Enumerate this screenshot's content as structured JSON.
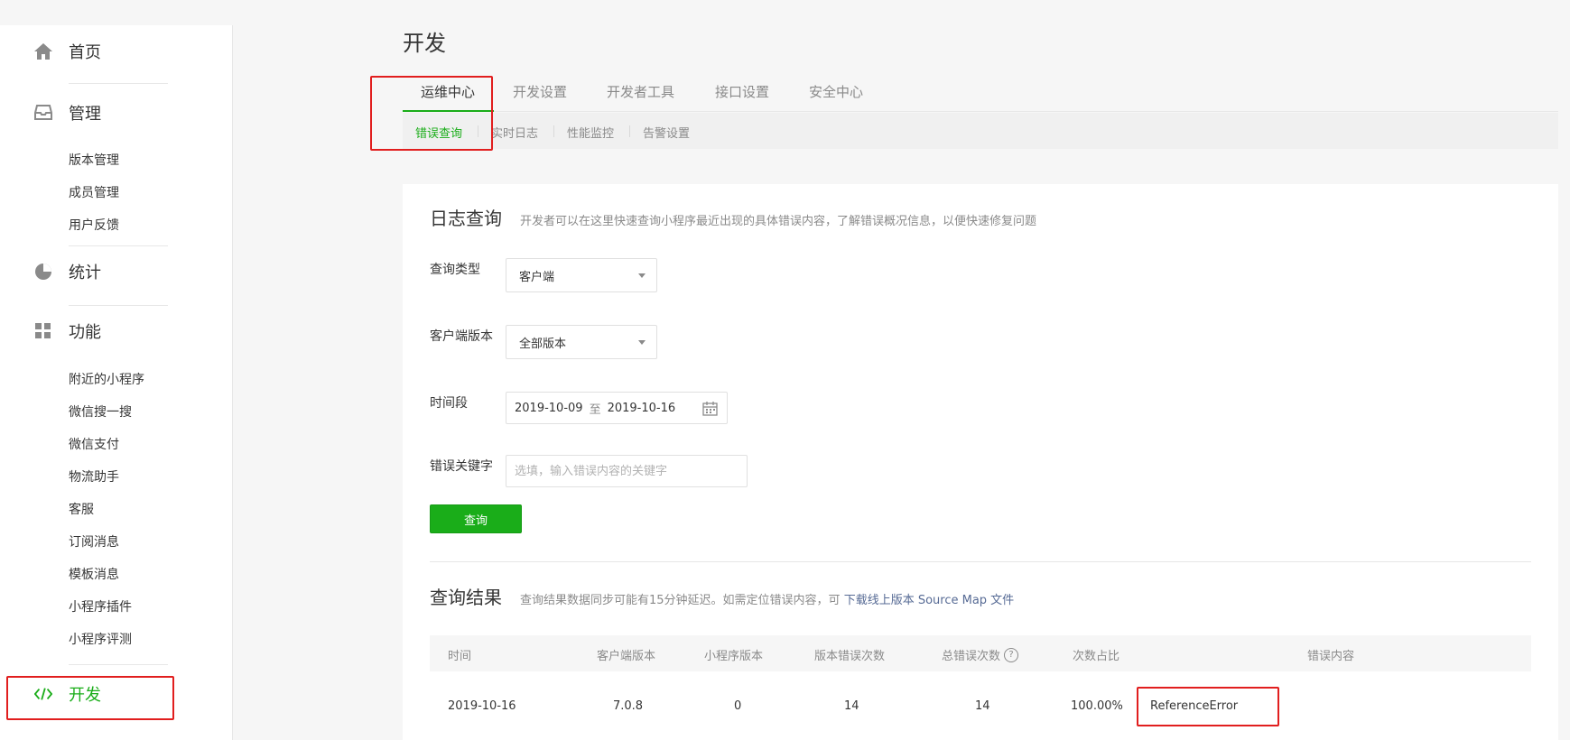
{
  "sidebar": {
    "home": {
      "label": "首页"
    },
    "manage": {
      "label": "管理",
      "items": [
        "版本管理",
        "成员管理",
        "用户反馈"
      ]
    },
    "stats": {
      "label": "统计"
    },
    "features": {
      "label": "功能",
      "items": [
        "附近的小程序",
        "微信搜一搜",
        "微信支付",
        "物流助手",
        "客服",
        "订阅消息",
        "模板消息",
        "小程序插件",
        "小程序评测"
      ]
    },
    "dev": {
      "label": "开发"
    }
  },
  "header": {
    "title": "开发"
  },
  "tabs": [
    "运维中心",
    "开发设置",
    "开发者工具",
    "接口设置",
    "安全中心"
  ],
  "subtabs": [
    "错误查询",
    "实时日志",
    "性能监控",
    "告警设置"
  ],
  "log_query": {
    "title": "日志查询",
    "desc": "开发者可以在这里快速查询小程序最近出现的具体错误内容，了解错误概况信息，以便快速修复问题",
    "query_type_label": "查询类型",
    "query_type_value": "客户端",
    "client_version_label": "客户端版本",
    "client_version_value": "全部版本",
    "period_label": "时间段",
    "date_from": "2019-10-09",
    "date_to_word": "至",
    "date_to": "2019-10-16",
    "keyword_label": "错误关键字",
    "keyword_placeholder": "选填，输入错误内容的关键字",
    "query_button": "查询"
  },
  "results": {
    "title": "查询结果",
    "desc": "查询结果数据同步可能有15分钟延迟。如需定位错误内容，可",
    "link": "下载线上版本 Source Map 文件",
    "columns": [
      "时间",
      "客户端版本",
      "小程序版本",
      "版本错误次数",
      "总错误次数",
      "次数占比",
      "错误内容"
    ],
    "rows": [
      {
        "time": "2019-10-16",
        "client_version": "7.0.8",
        "mp_version": "0",
        "version_errors": "14",
        "total_errors": "14",
        "ratio": "100.00%",
        "content": "ReferenceError"
      }
    ]
  },
  "colors": {
    "accent": "#1aad19",
    "highlight_box": "#e11e1e",
    "link": "#576b95"
  },
  "icons": [
    "home-icon",
    "inbox-icon",
    "pie-chart-icon",
    "grid-icon",
    "code-icon",
    "calendar-icon",
    "help-icon",
    "caret-down-icon"
  ]
}
